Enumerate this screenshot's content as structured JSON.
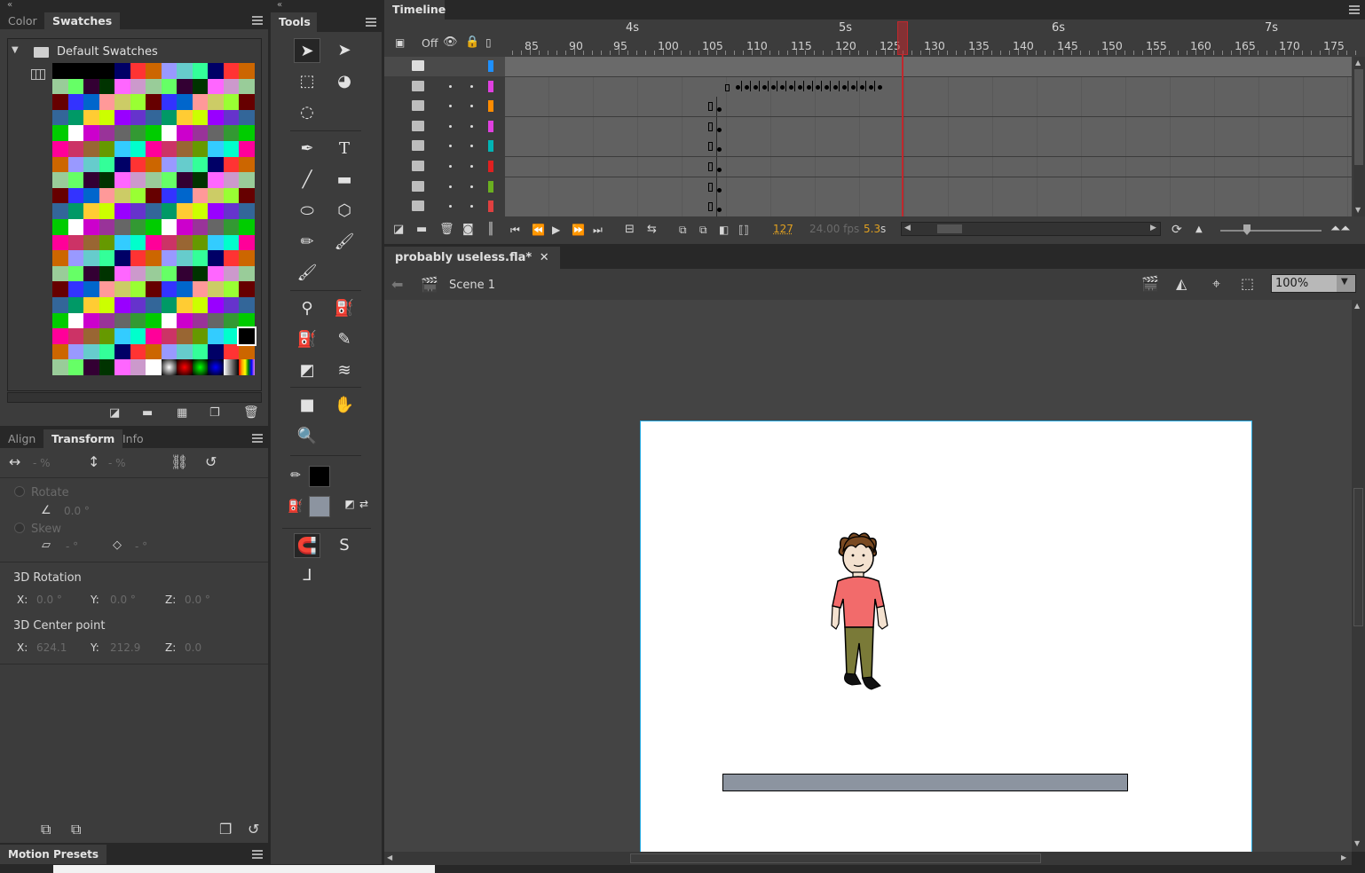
{
  "swatches_panel": {
    "tabs": [
      {
        "label": "Color"
      },
      {
        "label": "Swatches"
      }
    ],
    "folder_label": "Default Swatches"
  },
  "transform_panel": {
    "tabs": [
      {
        "label": "Align"
      },
      {
        "label": "Transform"
      },
      {
        "label": "Info"
      }
    ],
    "width_value": "- %",
    "height_value": "- %",
    "rotate_label": "Rotate",
    "rotate_value": "0.0 °",
    "skew_label": "Skew",
    "skew_h": "- °",
    "skew_v": "- °",
    "rotation3d_label": "3D Rotation",
    "rot_x_label": "X:",
    "rot_x": "0.0 °",
    "rot_y_label": "Y:",
    "rot_y": "0.0 °",
    "rot_z_label": "Z:",
    "rot_z": "0.0 °",
    "center3d_label": "3D Center point",
    "c_x_label": "X:",
    "c_x": "624.1",
    "c_y_label": "Y:",
    "c_y": "212.9",
    "c_z_label": "Z:",
    "c_z": "0.0"
  },
  "motion_presets": {
    "label": "Motion Presets"
  },
  "tools": {
    "label": "Tools"
  },
  "timeline": {
    "title": "Timeline",
    "onion_off": "Off",
    "seconds": [
      {
        "label": "4s",
        "frame": 96
      },
      {
        "label": "5s",
        "frame": 120
      },
      {
        "label": "6s",
        "frame": 144
      },
      {
        "label": "7s",
        "frame": 168
      }
    ],
    "frame_labels": [
      "85",
      "90",
      "95",
      "100",
      "105",
      "110",
      "115",
      "120",
      "125",
      "130",
      "135",
      "140",
      "145",
      "150",
      "155",
      "160",
      "165",
      "170",
      "175"
    ],
    "playhead_frame": 127,
    "current_frame": "127",
    "fps": "24.00 fps",
    "elapsed": "5.3",
    "elapsed_unit": "s",
    "layer_colors": [
      "#1e90ff",
      "#e040e0",
      "#ff8c00",
      "#e040e0",
      "#00b4b4",
      "#e02020",
      "#6ab020",
      "#e04040"
    ]
  },
  "document": {
    "tab_label": "probably useless.fla*",
    "scene_label": "Scene 1",
    "zoom": "100%"
  },
  "colors": {
    "stroke": "#000000",
    "fill": "#8c94a0",
    "playhead": "#c0282d",
    "stage_border": "#27aae1"
  }
}
